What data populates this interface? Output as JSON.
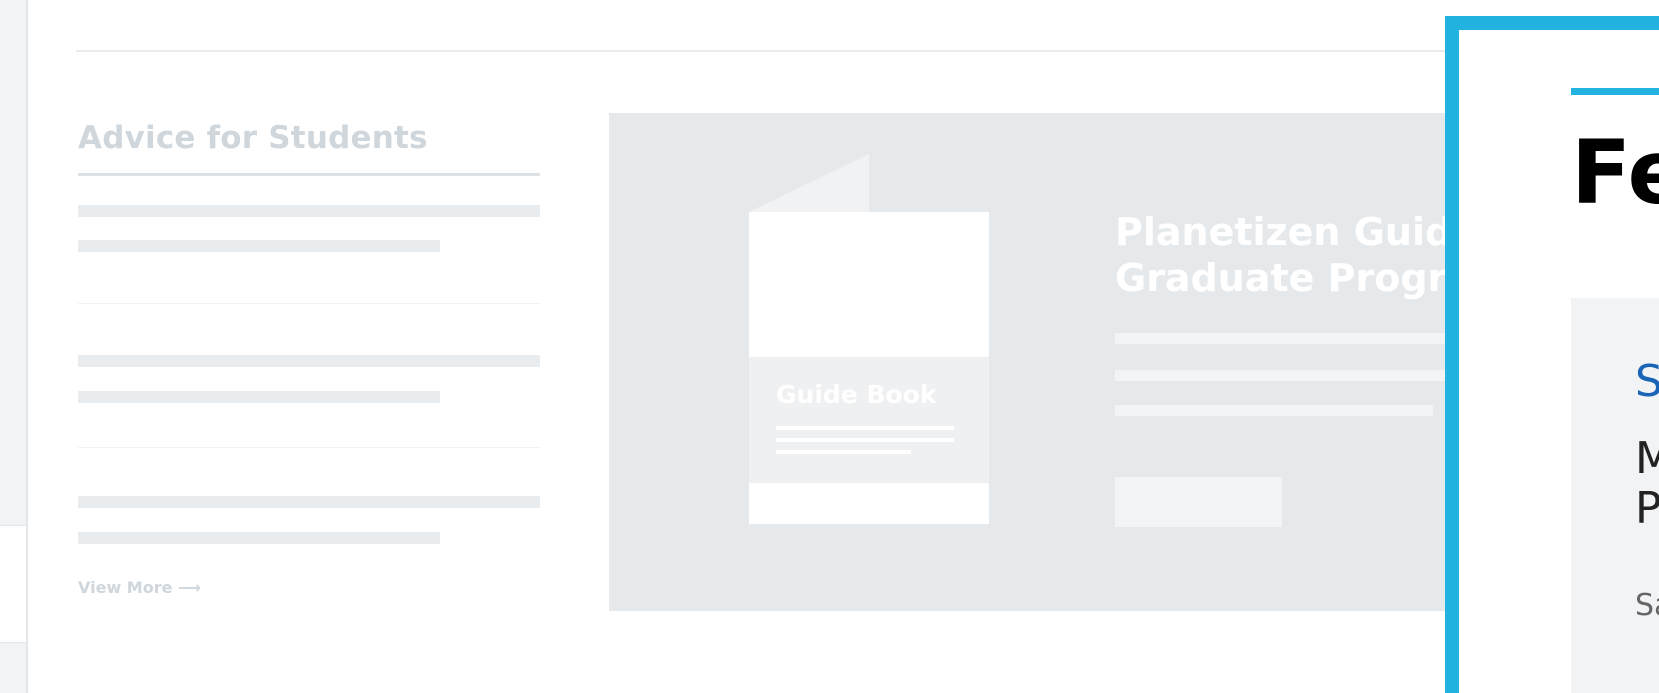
{
  "advice": {
    "title": "Advice for Students",
    "view_more": "View More",
    "view_more_arrow": "⟶"
  },
  "promo": {
    "book_label": "Guide Book",
    "title_line1": "Planetizen Guid",
    "title_line2": "Graduate Progr"
  },
  "featured": {
    "heading": "Fe",
    "card_line1": "S",
    "card_line2a": "M",
    "card_line2b": "P",
    "card_line3": "Sa"
  },
  "colors": {
    "accent": "#22b3e1",
    "link": "#1a64b5",
    "placeholder": "#cfd6dc",
    "skeleton": "#e9ecef",
    "promo_bg": "#e6e9eb"
  }
}
